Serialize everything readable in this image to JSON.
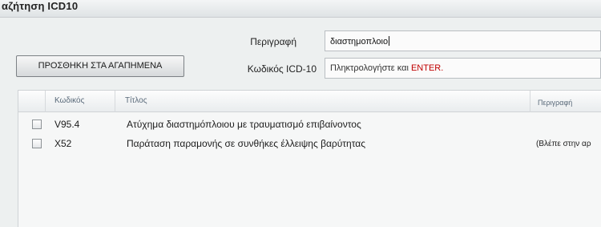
{
  "window": {
    "title": "αζήτηση ICD10"
  },
  "search": {
    "description_label": "Περιγραφή",
    "description_value": "διαστημοπλοιο",
    "code_label": "Κωδικός ICD-10",
    "code_placeholder_text": "Πληκτρολογήστε και ",
    "code_placeholder_enter": "ENTER."
  },
  "toolbar": {
    "favorites_label": "ΠΡΟΣΘΗΚΗ ΣΤΑ ΑΓΑΠΗΜΕΝΑ"
  },
  "table": {
    "columns": [
      "Κωδικός",
      "Τίτλος",
      "Περιγραφή"
    ],
    "rows": [
      {
        "code": "V95.4",
        "title": "Ατύχημα διαστημόπλοιου με τραυματισμό επιβαίνοντος",
        "description": ""
      },
      {
        "code": "X52",
        "title": "Παράταση παραμονής σε συνθήκες έλλειψης βαρύτητας",
        "description": "(Βλέπε στην αρ"
      }
    ]
  }
}
